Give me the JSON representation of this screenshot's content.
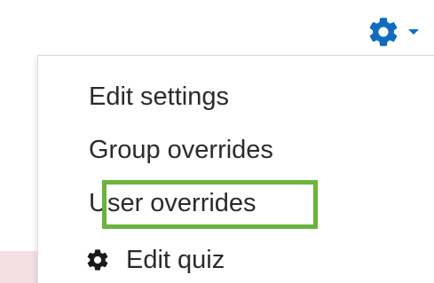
{
  "trigger": {
    "icon": "gear-icon",
    "caret_icon": "caret-down-icon",
    "color": "#0f6cbf"
  },
  "menu": {
    "items": [
      {
        "label": "Edit settings"
      },
      {
        "label": "Group overrides"
      },
      {
        "label": "User overrides",
        "highlighted": true
      },
      {
        "label": "Edit quiz",
        "icon": "gear-icon"
      }
    ],
    "highlight_color": "#6ab43b",
    "text_color": "#2b2b2b"
  }
}
